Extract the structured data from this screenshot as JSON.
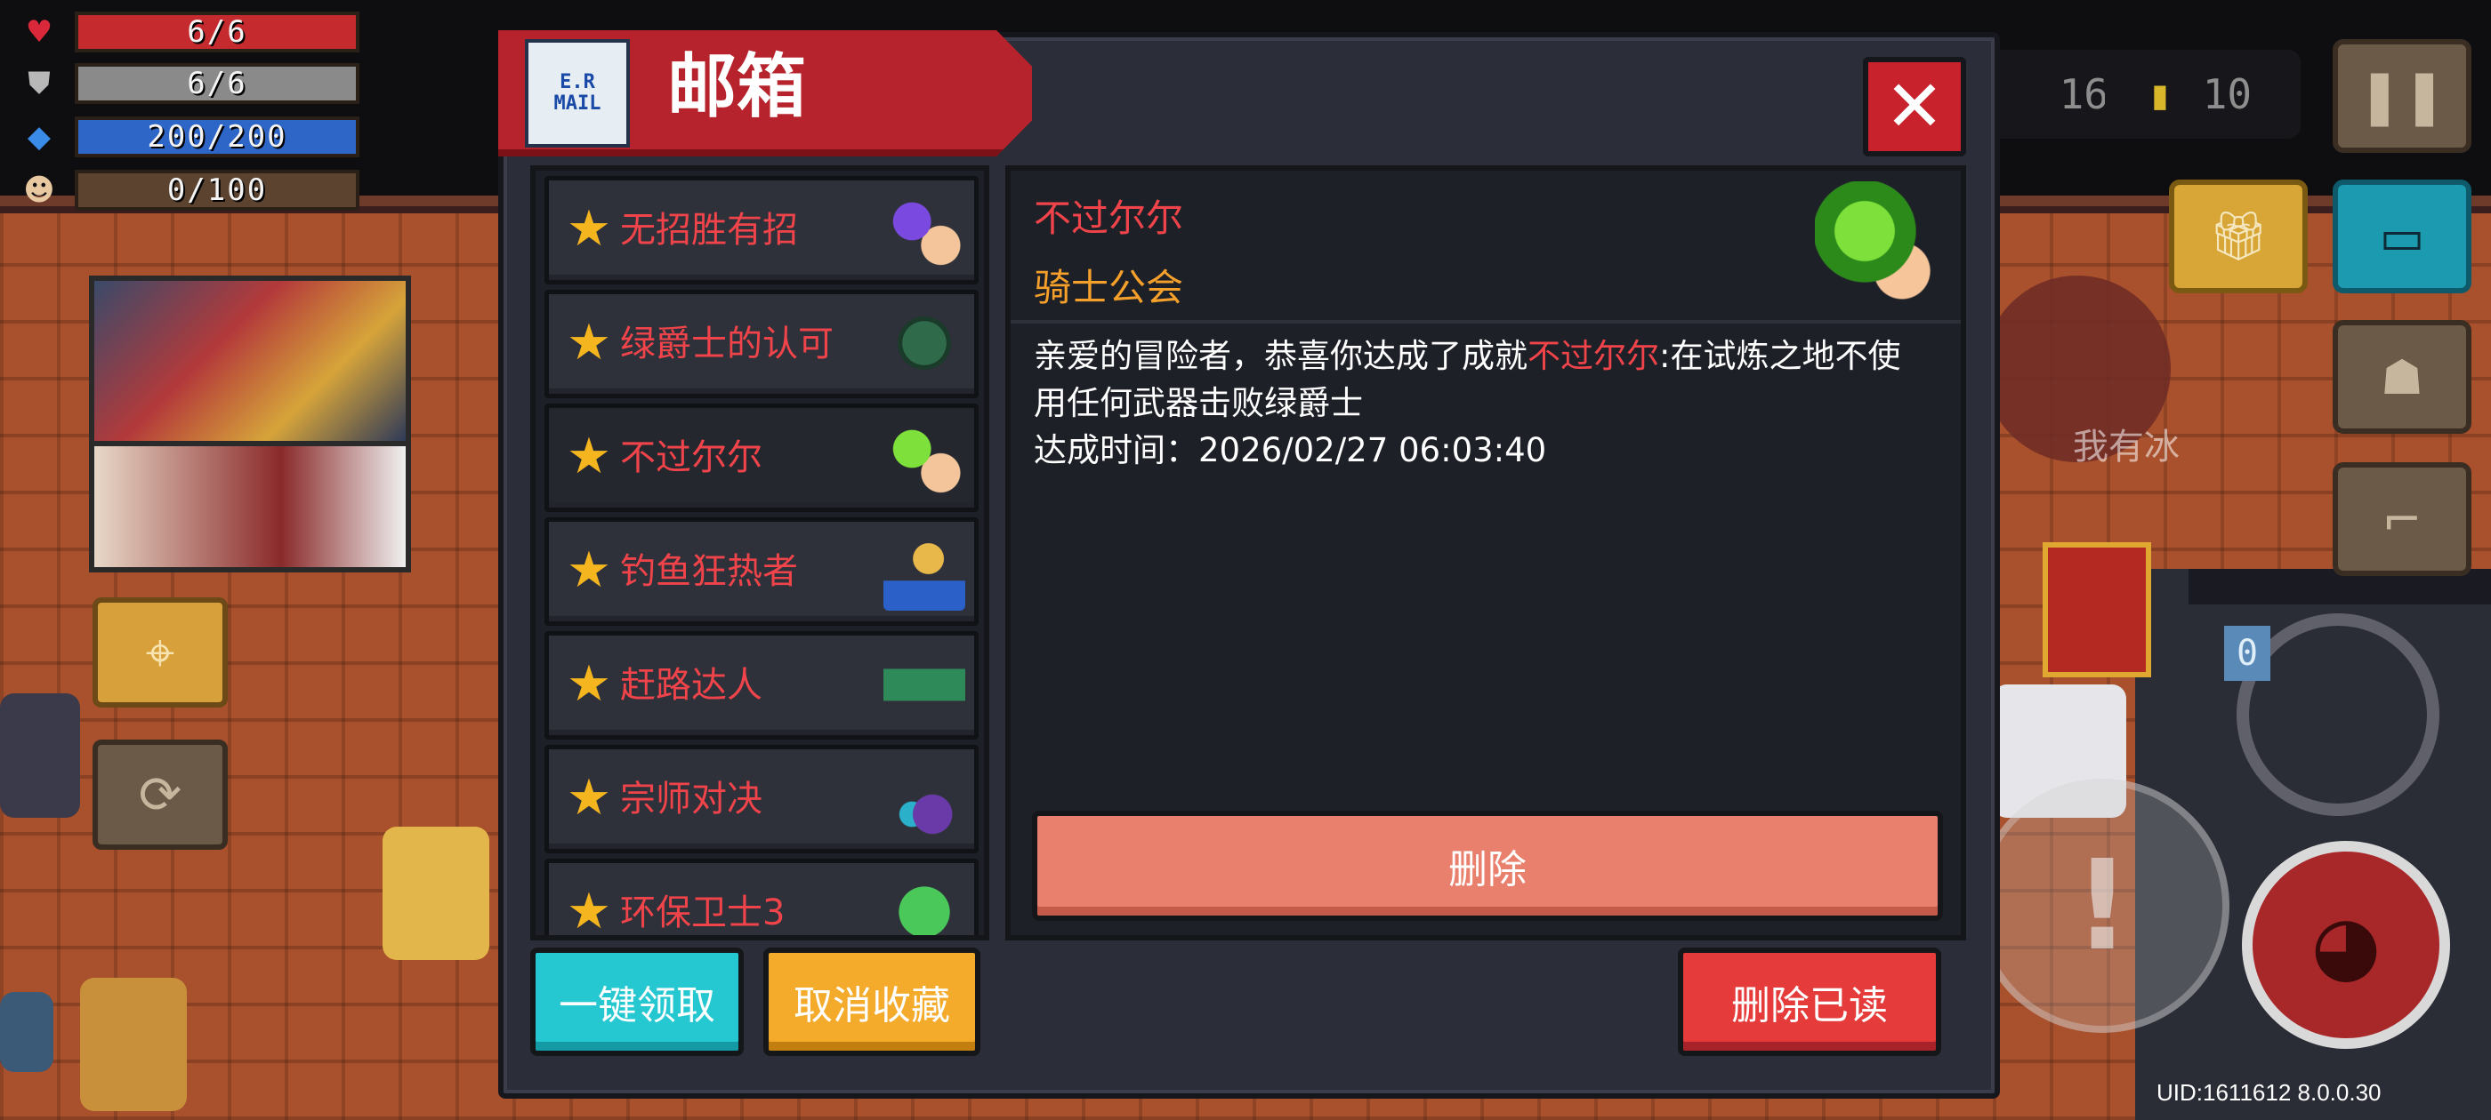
{
  "hud": {
    "hp": "6/6",
    "armor": "6/6",
    "energy": "200/200",
    "exp": "0/100",
    "gems": "16",
    "coins": "10"
  },
  "dialog": {
    "title": "邮箱",
    "mail_icon_text": "E.R MAIL",
    "mails": [
      {
        "title": "无招胜有招",
        "selected": false
      },
      {
        "title": "绿爵士的认可",
        "selected": false
      },
      {
        "title": "不过尔尔",
        "selected": true
      },
      {
        "title": "钓鱼狂热者",
        "selected": false
      },
      {
        "title": "赶路达人",
        "selected": false
      },
      {
        "title": "宗师对决",
        "selected": false
      },
      {
        "title": "环保卫士3",
        "selected": false
      }
    ],
    "detail": {
      "title": "不过尔尔",
      "sender": "骑士公会",
      "body_prefix": "亲爱的冒险者，恭喜你达成了成就",
      "body_highlight": "不过尔尔",
      "body_suffix": ":在试炼之地不使用任何武器击败绿爵士",
      "time_line": "达成时间：2026/02/27 06:03:40"
    },
    "buttons": {
      "delete": "删除",
      "claim_all": "一键领取",
      "unfavorite": "取消收藏",
      "delete_read": "删除已读"
    }
  },
  "scene_text": "我有冰",
  "weapon_badge": "0",
  "uid": "UID:1611612 8.0.0.30",
  "colors": {
    "accent_red": "#b7232c",
    "mail_title_red": "#f0444a",
    "sender_orange": "#f5a02a",
    "claim_cyan": "#25c8d0",
    "unfav_orange": "#f4aa2a",
    "delete_salmon": "#e9806d"
  }
}
